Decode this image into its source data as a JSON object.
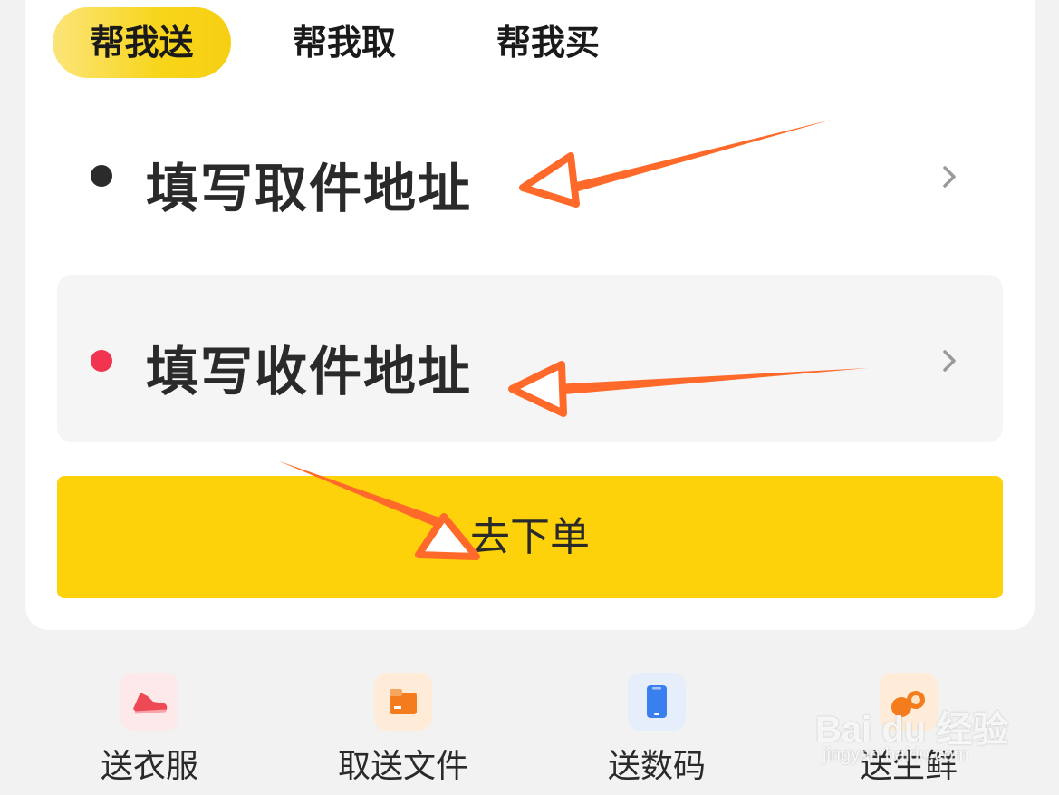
{
  "tabs": [
    {
      "label": "帮我送",
      "active": true
    },
    {
      "label": "帮我取",
      "active": false
    },
    {
      "label": "帮我买",
      "active": false
    }
  ],
  "pickup": {
    "label": "填写取件地址",
    "dot_color": "#2b2b2b"
  },
  "receive": {
    "label": "填写收件地址",
    "dot_color": "#f1344f"
  },
  "order_button": {
    "label": "去下单",
    "color": "#fdd20a"
  },
  "categories": [
    {
      "label": "送衣服",
      "icon": "sneaker-icon",
      "color": "#ee4a55"
    },
    {
      "label": "取送文件",
      "icon": "folder-icon",
      "color": "#f47c1c"
    },
    {
      "label": "送数码",
      "icon": "phone-icon",
      "color": "#3a7ff0"
    },
    {
      "label": "送生鲜",
      "icon": "fresh-food-icon",
      "color": "#f47c1c"
    }
  ],
  "watermark": {
    "main": "Bai du 经验",
    "sub": "jingyan.baidu.com"
  },
  "annotation": {
    "arrow_color": "#ff6a2b"
  }
}
